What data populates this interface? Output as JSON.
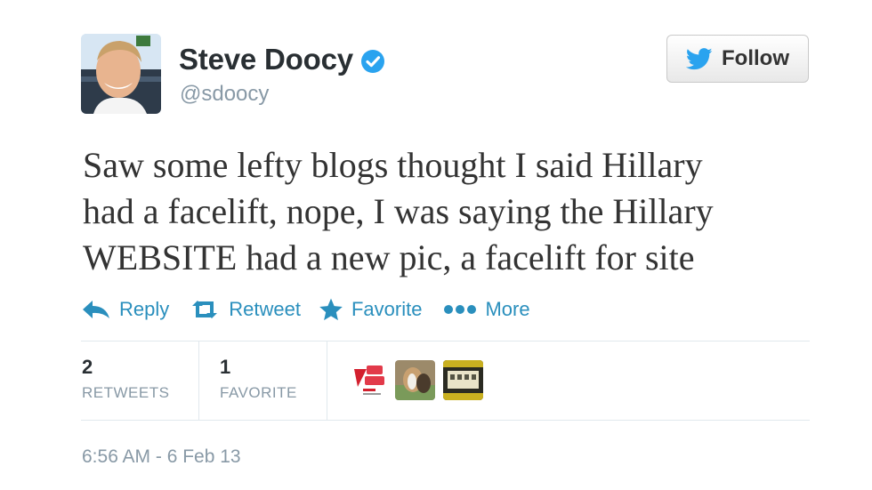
{
  "user": {
    "display_name": "Steve Doocy",
    "handle": "@sdoocy",
    "verified": true
  },
  "follow_button": {
    "label": "Follow"
  },
  "tweet": {
    "lines": [
      "Saw some lefty blogs thought I said Hillary",
      "had a facelift, nope, I was saying the Hillary",
      "WEBSITE had a new pic, a facelift for site"
    ]
  },
  "actions": {
    "reply": "Reply",
    "retweet": "Retweet",
    "favorite": "Favorite",
    "more": "More"
  },
  "stats": {
    "retweets": {
      "value": "2",
      "label": "RETWEETS"
    },
    "favorites": {
      "value": "1",
      "label": "FAVORITE"
    }
  },
  "timestamp": "6:56 AM - 6 Feb 13",
  "colors": {
    "link": "#2a8fbd",
    "verified": "#1da1f2",
    "muted": "#8899a6"
  }
}
